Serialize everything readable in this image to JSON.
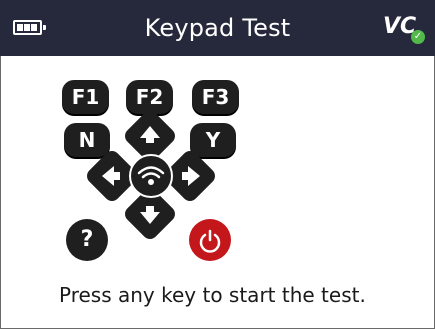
{
  "header": {
    "title": "Keypad Test",
    "brand": "VC",
    "battery_icon": "battery-icon",
    "brand_badge_icon": "check-icon"
  },
  "keypad": {
    "function_keys": [
      "F1",
      "F2",
      "F3"
    ],
    "no_key": "N",
    "yes_key": "Y",
    "help_key": "?",
    "icons": {
      "up": "arrow-up-icon",
      "down": "arrow-down-icon",
      "left": "arrow-left-icon",
      "right": "arrow-right-icon",
      "center": "wireless-icon",
      "power": "power-icon"
    }
  },
  "message": "Press any key to start the test.",
  "colors": {
    "header_bg": "#26293c",
    "key": "#1f1f1f",
    "power": "#c4171b",
    "badge": "#53b84a"
  }
}
